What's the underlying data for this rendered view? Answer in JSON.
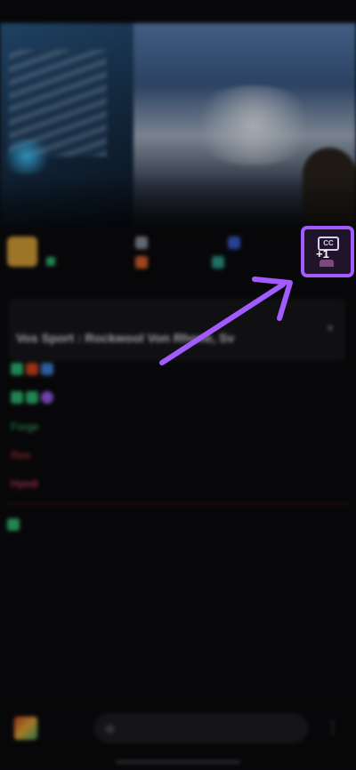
{
  "status": {
    "time": "",
    "right": ""
  },
  "channel": {
    "name": "",
    "sub": "",
    "badge1": "",
    "badge2": "",
    "badge3": "",
    "badge4": ""
  },
  "pinned": {
    "meta": "",
    "by": "",
    "title": "Vos Sport : Rockwool Von Rhone, Sv"
  },
  "chat": [
    {
      "ts": "",
      "user": "",
      "text": ""
    },
    {
      "ts": "",
      "user": "",
      "text": ""
    },
    {
      "ts": "",
      "user": "Forge",
      "text": ""
    },
    {
      "ts": "",
      "user": "Reo",
      "text": ""
    },
    {
      "ts": "",
      "user": "Hyedi",
      "text": ""
    }
  ],
  "divider_label": "",
  "prompt_text": "",
  "last_msg": {
    "user": "",
    "text": ""
  },
  "input": {
    "user_label": "",
    "placeholder": ""
  },
  "subtitle_button": {
    "icon": "closed-captions-icon",
    "count_label": "+1"
  },
  "colors": {
    "accent": "#a15bff",
    "background": "#0b0b0d",
    "username_red": "#e03838",
    "username_green": "#39c46b"
  }
}
